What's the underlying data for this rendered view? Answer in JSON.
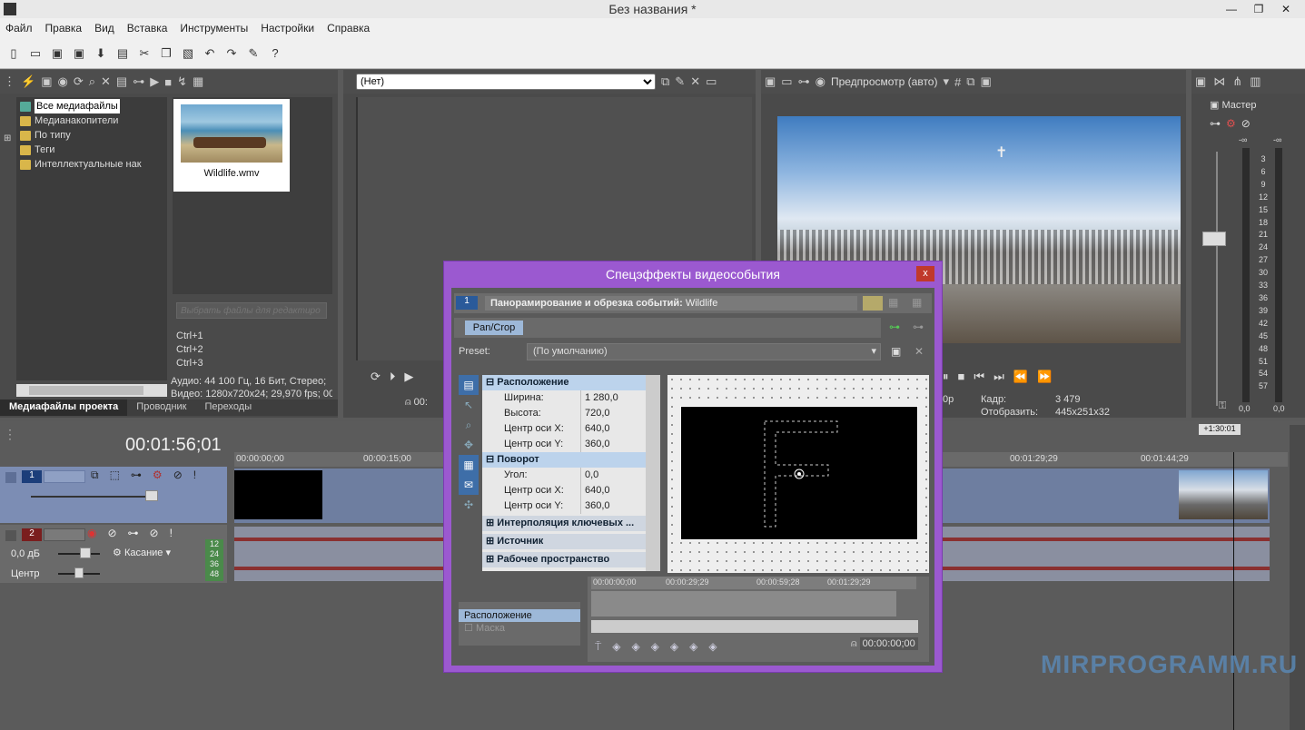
{
  "window": {
    "title": "Без названия *"
  },
  "menu": [
    "Файл",
    "Правка",
    "Вид",
    "Вставка",
    "Инструменты",
    "Настройки",
    "Справка"
  ],
  "explorer": {
    "tree": [
      "Все медиафайлы",
      "Медианакопители",
      "По типу",
      "Теги",
      "Интеллектуальные нак"
    ],
    "thumb_name": "Wildlife.wmv",
    "filter_placeholder": "Выбрать файлы для редактиро",
    "shortcuts": [
      "Ctrl+1",
      "Ctrl+2",
      "Ctrl+3"
    ],
    "audio_info": "Аудио: 44 100 Гц, 16 Бит, Стерео;",
    "video_info": "Видео: 1280x720x24; 29,970 fps; 00",
    "tabs": [
      "Медиафайлы проекта",
      "Проводник",
      "Переходы"
    ]
  },
  "trimmer": {
    "select": "(Нет)",
    "time": "00:"
  },
  "preview": {
    "mode": "Предпросмотр (авто)",
    "frame_label": "Кадр:",
    "frame_value": "3 479",
    "display_label": "Отобразить:",
    "display_value": "445x251x32",
    "left_label": "0р"
  },
  "master": {
    "label": "Мастер",
    "scale": [
      "3",
      "6",
      "9",
      "12",
      "15",
      "18",
      "21",
      "24",
      "27",
      "30",
      "33",
      "36",
      "39",
      "42",
      "45",
      "48",
      "51",
      "54",
      "57"
    ],
    "bottom": [
      "0,0",
      "0,0"
    ],
    "top": [
      "-∞",
      "-∞"
    ]
  },
  "timeline": {
    "timecode": "00:01:56;01",
    "ruler": [
      "00:00:00;00",
      "00:00:15;00",
      "00:01:29;29",
      "00:01:44;29"
    ],
    "marker": "+1:30:01",
    "track1_num": "1",
    "track2_num": "2",
    "audio_db": "0,0 дБ",
    "audio_pan": "Центр",
    "touch_label": "Касание",
    "meter": [
      "12",
      "24",
      "36",
      "48"
    ]
  },
  "dialog": {
    "title": "Спецэффекты видеособытия",
    "close": "x",
    "header_label": "Панорамирование и обрезка событий:",
    "header_value": "Wildlife",
    "chain_item": "Pan/Crop",
    "preset_label": "Preset:",
    "preset_value": "(По умолчанию)",
    "sections": {
      "position": "Расположение",
      "rotation": "Поворот",
      "interp": "Интерполяция ключевых ...",
      "source": "Источник",
      "workspace": "Рабочее пространство"
    },
    "position_rows": [
      [
        "Ширина:",
        "1 280,0"
      ],
      [
        "Высота:",
        "720,0"
      ],
      [
        "Центр оси X:",
        "640,0"
      ],
      [
        "Центр оси Y:",
        "360,0"
      ]
    ],
    "rotation_rows": [
      [
        "Угол:",
        "0,0"
      ],
      [
        "Центр оси X:",
        "640,0"
      ],
      [
        "Центр оси Y:",
        "360,0"
      ]
    ],
    "kf_ruler": [
      "00:00:00;00",
      "00:00:29;29",
      "00:00:59;28",
      "00:01:29;29"
    ],
    "kf_tracks": [
      "Расположение",
      "Маска"
    ],
    "kf_time": "00:00:00;00",
    "frame_letter": "F"
  },
  "watermark": "MIRPROGRAMM.RU"
}
